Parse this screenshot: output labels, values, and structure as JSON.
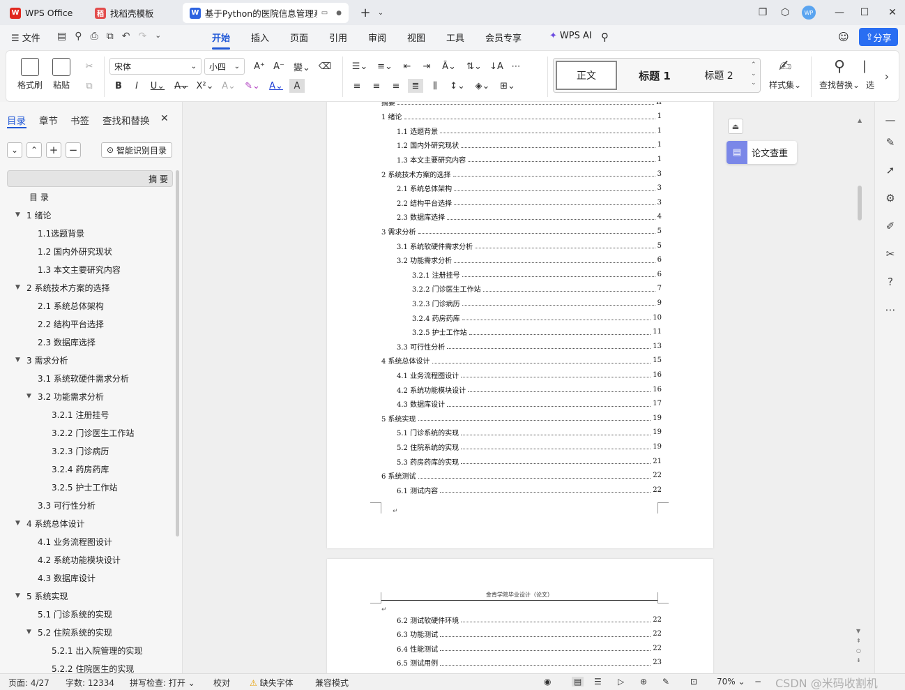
{
  "tabs": [
    {
      "label": "WPS Office",
      "icon": "wps-logo-icon"
    },
    {
      "label": "找稻壳模板",
      "icon": "docer-icon"
    },
    {
      "label": "基于Python的医院信息管理系",
      "icon": "word-doc-icon"
    }
  ],
  "menu": {
    "file": "文件",
    "items": [
      "开始",
      "插入",
      "页面",
      "引用",
      "审阅",
      "视图",
      "工具",
      "会员专享"
    ],
    "ai": "WPS AI",
    "share": "分享"
  },
  "ribbon": {
    "format_painter": "格式刷",
    "paste": "粘贴",
    "font": "宋体",
    "font_size": "小四",
    "styles": [
      "正文",
      "标题 1",
      "标题 2"
    ],
    "style_set": "样式集",
    "find_replace": "查找替换",
    "select": "选"
  },
  "left_panel": {
    "tabs": [
      "目录",
      "章节",
      "书签",
      "查找和替换"
    ],
    "smart_toc": "智能识别目录",
    "items": [
      {
        "label": "摘   要",
        "level": 0,
        "expand": ""
      },
      {
        "label": "目   录",
        "level": 0,
        "expand": ""
      },
      {
        "label": "1 绪论",
        "level": 0,
        "expand": "▼"
      },
      {
        "label": "1.1选题背景",
        "level": 1,
        "expand": ""
      },
      {
        "label": "1.2 国内外研究现状",
        "level": 1,
        "expand": ""
      },
      {
        "label": "1.3 本文主要研究内容",
        "level": 1,
        "expand": ""
      },
      {
        "label": "2 系统技术方案的选择",
        "level": 0,
        "expand": "▼"
      },
      {
        "label": "2.1 系统总体架构",
        "level": 1,
        "expand": ""
      },
      {
        "label": "2.2 结构平台选择",
        "level": 1,
        "expand": ""
      },
      {
        "label": "2.3 数据库选择",
        "level": 1,
        "expand": ""
      },
      {
        "label": "3  需求分析",
        "level": 0,
        "expand": "▼"
      },
      {
        "label": "3.1  系统软硬件需求分析",
        "level": 1,
        "expand": ""
      },
      {
        "label": "3.2  功能需求分析",
        "level": 1,
        "expand": "▼"
      },
      {
        "label": "3.2.1  注册挂号",
        "level": 2,
        "expand": ""
      },
      {
        "label": "3.2.2  门诊医生工作站",
        "level": 2,
        "expand": ""
      },
      {
        "label": "3.2.3  门诊病历",
        "level": 2,
        "expand": ""
      },
      {
        "label": "3.2.4  药房药库",
        "level": 2,
        "expand": ""
      },
      {
        "label": "3.2.5  护士工作站",
        "level": 2,
        "expand": ""
      },
      {
        "label": "3.3  可行性分析",
        "level": 1,
        "expand": ""
      },
      {
        "label": "4 系统总体设计",
        "level": 0,
        "expand": "▼"
      },
      {
        "label": "4.1  业务流程图设计",
        "level": 1,
        "expand": ""
      },
      {
        "label": "4.2 系统功能模块设计",
        "level": 1,
        "expand": ""
      },
      {
        "label": "4.3  数据库设计",
        "level": 1,
        "expand": ""
      },
      {
        "label": "5  系统实现",
        "level": 0,
        "expand": "▼"
      },
      {
        "label": "5.1 门诊系统的实现",
        "level": 1,
        "expand": ""
      },
      {
        "label": "5.2  住院系统的实现",
        "level": 1,
        "expand": "▼"
      },
      {
        "label": "5.2.1  出入院管理的实现",
        "level": 2,
        "expand": ""
      },
      {
        "label": "5.2.2  住院医生的实现",
        "level": 2,
        "expand": ""
      }
    ]
  },
  "document": {
    "page1_lines": [
      {
        "text": "摘要",
        "page": "II",
        "level": 0
      },
      {
        "text": "1 绪论",
        "page": "1",
        "level": 0
      },
      {
        "text": "1.1 选题背景",
        "page": "1",
        "level": 1
      },
      {
        "text": "1.2 国内外研究现状",
        "page": "1",
        "level": 1
      },
      {
        "text": "1.3 本文主要研究内容",
        "page": "1",
        "level": 1
      },
      {
        "text": "2 系统技术方案的选择",
        "page": "3",
        "level": 0
      },
      {
        "text": "2.1 系统总体架构",
        "page": "3",
        "level": 1
      },
      {
        "text": "2.2 结构平台选择",
        "page": "3",
        "level": 1
      },
      {
        "text": "2.3 数据库选择",
        "page": "4",
        "level": 1
      },
      {
        "text": "3 需求分析",
        "page": "5",
        "level": 0
      },
      {
        "text": "3.1 系统软硬件需求分析",
        "page": "5",
        "level": 1
      },
      {
        "text": "3.2 功能需求分析",
        "page": "6",
        "level": 1
      },
      {
        "text": "3.2.1 注册挂号",
        "page": "6",
        "level": 2
      },
      {
        "text": "3.2.2 门诊医生工作站",
        "page": "7",
        "level": 2
      },
      {
        "text": "3.2.3 门诊病历",
        "page": "9",
        "level": 2
      },
      {
        "text": "3.2.4 药房药库",
        "page": "10",
        "level": 2
      },
      {
        "text": "3.2.5 护士工作站",
        "page": "11",
        "level": 2
      },
      {
        "text": "3.3 可行性分析",
        "page": "13",
        "level": 1
      },
      {
        "text": "4 系统总体设计",
        "page": "15",
        "level": 0
      },
      {
        "text": "4.1 业务流程图设计",
        "page": "16",
        "level": 1
      },
      {
        "text": "4.2 系统功能模块设计",
        "page": "16",
        "level": 1
      },
      {
        "text": "4.3 数据库设计",
        "page": "17",
        "level": 1
      },
      {
        "text": "5 系统实现",
        "page": "19",
        "level": 0
      },
      {
        "text": "5.1 门诊系统的实现",
        "page": "19",
        "level": 1
      },
      {
        "text": "5.2 住院系统的实现",
        "page": "19",
        "level": 1
      },
      {
        "text": "5.3 药房药库的实现",
        "page": "21",
        "level": 1
      },
      {
        "text": "6 系统测试",
        "page": "22",
        "level": 0
      },
      {
        "text": "6.1 测试内容",
        "page": "22",
        "level": 1
      }
    ],
    "page2_header": "金肯学院毕业设计（论文）",
    "page2_lines": [
      {
        "text": "6.2 测试软硬件环境",
        "page": "22",
        "level": 1
      },
      {
        "text": "6.3 功能测试",
        "page": "22",
        "level": 1
      },
      {
        "text": "6.4 性能测试",
        "page": "22",
        "level": 1
      },
      {
        "text": "6.5 测试用例",
        "page": "23",
        "level": 1
      }
    ],
    "float_button": "论文查重"
  },
  "status": {
    "page": "页面: 4/27",
    "words": "字数: 12334",
    "spell": "拼写检查: 打开",
    "proof": "校对",
    "missing_font": "缺失字体",
    "compat": "兼容模式",
    "zoom": "70%"
  },
  "watermark": "CSDN @米码收割机",
  "colors": {
    "accent": "#1f57d6",
    "wps_red": "#e0281f"
  }
}
